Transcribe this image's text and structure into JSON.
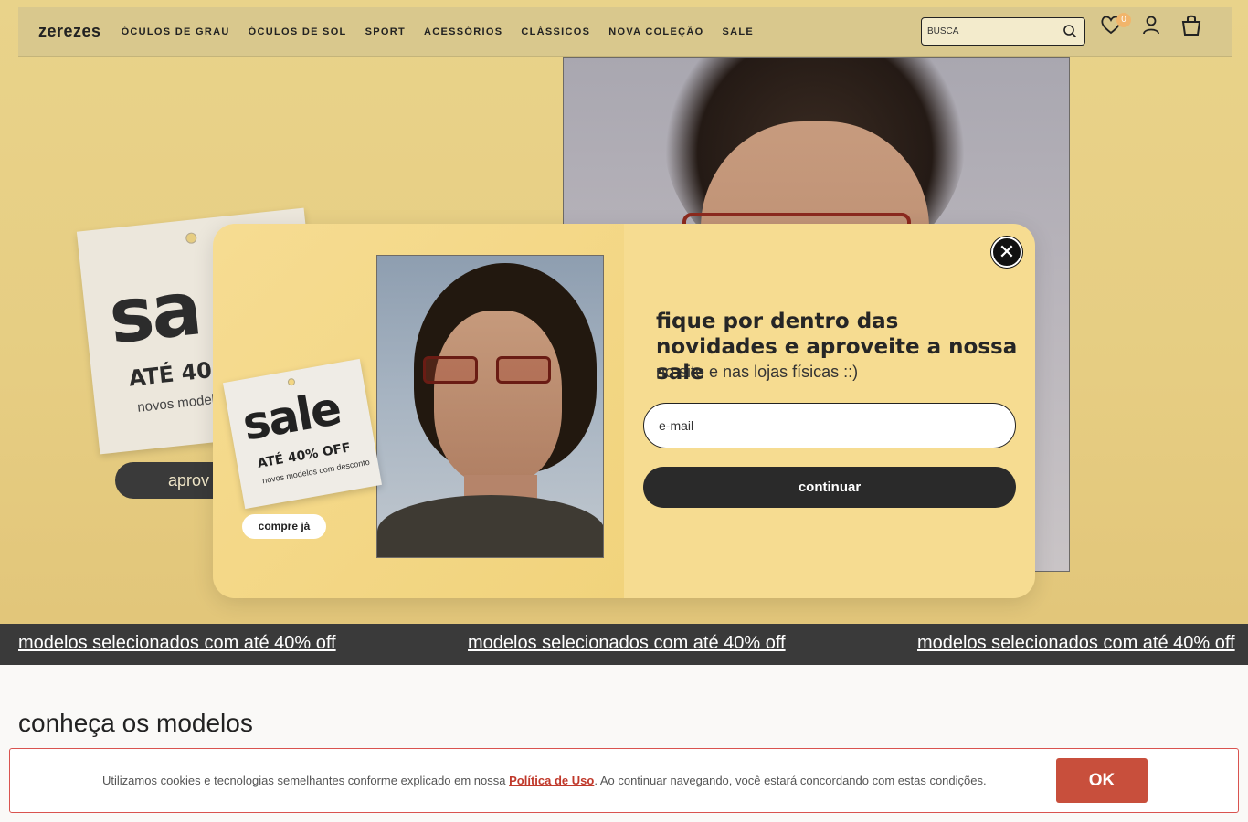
{
  "header": {
    "logo": "zerezes",
    "nav": [
      "ÓCULOS DE GRAU",
      "ÓCULOS DE SOL",
      "SPORT",
      "ACESSÓRIOS",
      "CLÁSSICOS",
      "NOVA COLEÇÃO",
      "SALE"
    ],
    "search_placeholder": "BUSCA",
    "wishlist_count": "0",
    "icons": [
      "search-icon",
      "heart-icon",
      "user-icon",
      "bag-icon"
    ]
  },
  "hero": {
    "tag_big": "sa",
    "tag_off": "ATÉ 40",
    "tag_sub": "novos model",
    "button_label": "aprov"
  },
  "modal": {
    "tag_big": "sale",
    "tag_off": "ATÉ 40% OFF",
    "tag_sub": "novos modelos com desconto",
    "buy_label": "compre já",
    "close_label": "✕",
    "title": "fique por dentro das novidades e aproveite a nossa sale",
    "subtitle": "no site e nas lojas físicas ::)",
    "email_placeholder": "e-mail",
    "continue_label": "continuar"
  },
  "ticker": {
    "items": [
      "modelos selecionados com até 40% off",
      "modelos selecionados com até 40% off",
      "modelos selecionados com até 40% off"
    ]
  },
  "section": {
    "title": "conheça os modelos"
  },
  "cookie": {
    "text_before": "Utilizamos cookies e tecnologias semelhantes conforme explicado em nossa ",
    "link_label": "Política de Uso",
    "text_after": ". Ao continuar navegando, você estará concordando com estas condições.",
    "ok_label": "OK"
  },
  "colors": {
    "hero_bg": "#e9d38a",
    "modal_bg": "#f6dc91",
    "dark": "#2a2a2a",
    "ok_button": "#c84f3c",
    "badge": "#f1b56b"
  }
}
